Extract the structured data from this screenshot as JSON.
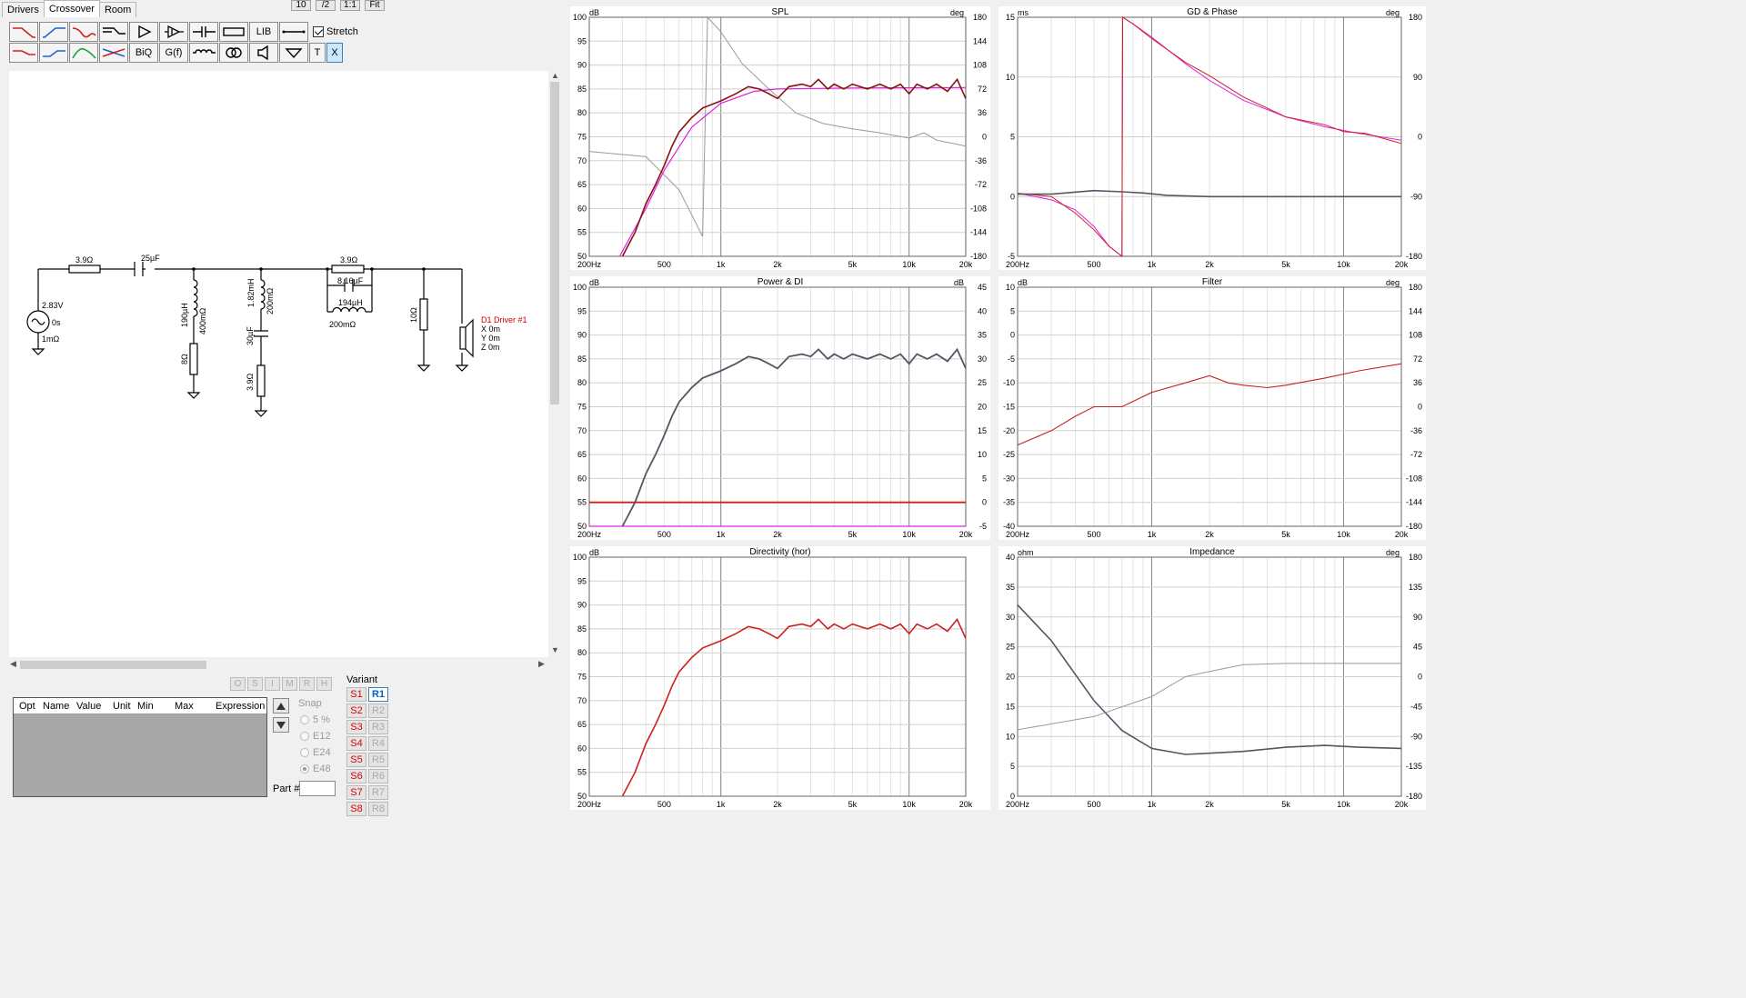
{
  "tabs": [
    "Drivers",
    "Crossover",
    "Room"
  ],
  "zoom": [
    "10",
    "/2",
    "1:1",
    "Fit"
  ],
  "toolbar": {
    "row1": [
      "lowpass-icon",
      "highpass-icon",
      "bandpass-icon",
      "shelf-icon",
      "buffer-icon",
      "opamp-icon",
      "capacitor-icon",
      "resistor-icon",
      "LIB",
      "wire-icon"
    ],
    "row2": [
      "lowpass-red-icon",
      "highpass-blue-icon",
      "bandpass-green-icon",
      "crossover-icon",
      "BiQ",
      "G(f)",
      "inductor-icon",
      "transformer-icon",
      "speaker-icon",
      "ground-icon",
      "T",
      "X"
    ],
    "stretch_label": "Stretch"
  },
  "schematic": {
    "source_v": "2.83V",
    "source_t": "0s",
    "source_r": "1mΩ",
    "r1": "3.9Ω",
    "c1": "25µF",
    "l1": "190µH",
    "l1r": "400mΩ",
    "r2": "8Ω",
    "l2": "1.82mH",
    "l2r": "200mΩ",
    "c2": "30µF",
    "r3": "3.9Ω",
    "r4": "3.9Ω",
    "c3": "8.16µF",
    "l3": "194µH",
    "l3r": "200mΩ",
    "r5": "10Ω",
    "driver_name": "D1 Driver #1",
    "driver_x": "X 0m",
    "driver_y": "Y 0m",
    "driver_z": "Z 0m"
  },
  "opt_buttons": [
    "O",
    "S",
    "I",
    "M",
    "R",
    "H"
  ],
  "table_headers": [
    "Opt",
    "Name",
    "Value",
    "Unit",
    "Min",
    "Max",
    "Expression"
  ],
  "snap": {
    "label": "Snap",
    "options": [
      "5 %",
      "E12",
      "E24",
      "E48"
    ],
    "selected": "E48"
  },
  "part_label": "Part #",
  "variant": {
    "label": "Variant",
    "s": [
      "S1",
      "S2",
      "S3",
      "S4",
      "S5",
      "S6",
      "S7",
      "S8"
    ],
    "r": [
      "R1",
      "R2",
      "R3",
      "R4",
      "R5",
      "R6",
      "R7",
      "R8"
    ],
    "active_r": "R1"
  },
  "x_ticks": [
    "200Hz",
    "500",
    "1k",
    "2k",
    "5k",
    "10k",
    "20k"
  ],
  "graphs": [
    {
      "id": "spl",
      "title": "SPL",
      "left_unit": "dB",
      "right_unit": "deg",
      "left_ticks": [
        "100",
        "95",
        "90",
        "85",
        "80",
        "75",
        "70",
        "65",
        "60",
        "55",
        "50"
      ],
      "right_ticks": [
        "180",
        "144",
        "108",
        "72",
        "36",
        "0",
        "-36",
        "-72",
        "-108",
        "-144",
        "-180"
      ]
    },
    {
      "id": "gd",
      "title": "GD & Phase",
      "left_unit": "ms",
      "right_unit": "deg",
      "left_ticks": [
        "15",
        "10",
        "5",
        "0",
        "-5"
      ],
      "right_ticks": [
        "180",
        "90",
        "0",
        "-90",
        "-180"
      ]
    },
    {
      "id": "power",
      "title": "Power & DI",
      "left_unit": "dB",
      "right_unit": "dB",
      "left_ticks": [
        "100",
        "95",
        "90",
        "85",
        "80",
        "75",
        "70",
        "65",
        "60",
        "55",
        "50"
      ],
      "right_ticks": [
        "45",
        "40",
        "35",
        "30",
        "25",
        "20",
        "15",
        "10",
        "5",
        "0",
        "-5"
      ]
    },
    {
      "id": "filter",
      "title": "Filter",
      "left_unit": "dB",
      "right_unit": "deg",
      "left_ticks": [
        "10",
        "5",
        "0",
        "-5",
        "-10",
        "-15",
        "-20",
        "-25",
        "-30",
        "-35",
        "-40"
      ],
      "right_ticks": [
        "180",
        "144",
        "108",
        "72",
        "36",
        "0",
        "-36",
        "-72",
        "-108",
        "-144",
        "-180"
      ]
    },
    {
      "id": "dir",
      "title": "Directivity (hor)",
      "left_unit": "dB",
      "right_unit": "",
      "left_ticks": [
        "100",
        "95",
        "90",
        "85",
        "80",
        "75",
        "70",
        "65",
        "60",
        "55",
        "50"
      ],
      "right_ticks": []
    },
    {
      "id": "imp",
      "title": "Impedance",
      "left_unit": "ohm",
      "right_unit": "deg",
      "left_ticks": [
        "40",
        "35",
        "30",
        "25",
        "20",
        "15",
        "10",
        "5",
        "0"
      ],
      "right_ticks": [
        "180",
        "135",
        "90",
        "45",
        "0",
        "-45",
        "-90",
        "-135",
        "-180"
      ]
    }
  ],
  "colors": {
    "red": "#cc2020",
    "darkred": "#8b1010",
    "magenta": "#e020e0",
    "gray": "#999999",
    "dark": "#555566"
  }
}
